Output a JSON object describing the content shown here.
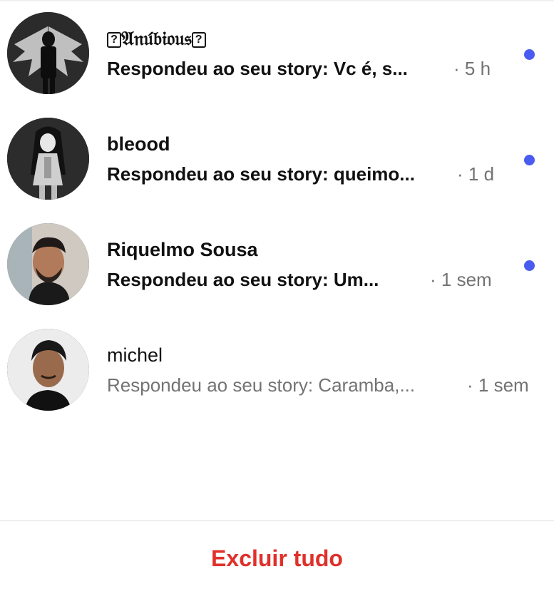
{
  "conversations": [
    {
      "name": "❓𝔄𝔫𝔲́𝔟𝔦𝔬𝔲𝔰❓",
      "name_display": "𝔄𝔫𝔲́𝔟𝔦𝔬𝔲𝔰",
      "preview": "Respondeu ao seu story: Vc é, s...",
      "time": "· 5 h",
      "unread": true
    },
    {
      "name_display": "bleood",
      "preview": "Respondeu ao seu story: queimo...",
      "time": "· 1 d",
      "unread": true
    },
    {
      "name_display": "Riquelmo Sousa",
      "preview": "Respondeu ao seu story: Um...",
      "time": "· 1 sem",
      "unread": true
    },
    {
      "name_display": "michel",
      "preview": "Respondeu ao seu story: Caramba,...",
      "time": "· 1 sem",
      "unread": false
    }
  ],
  "footer": {
    "delete_all_label": "Excluir tudo"
  },
  "colors": {
    "unread_dot": "#4a5cf0",
    "delete_action": "#e0302a",
    "secondary_text": "#737373"
  }
}
